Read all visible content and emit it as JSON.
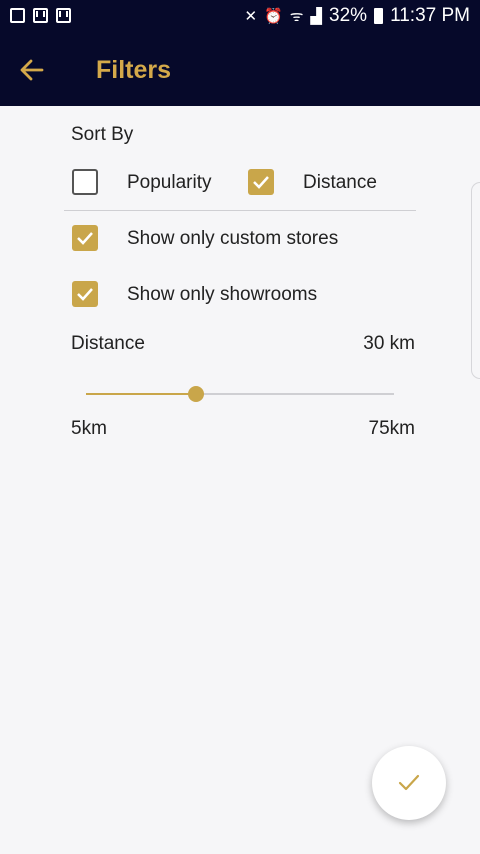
{
  "status_bar": {
    "battery": "32%",
    "time": "11:37 PM",
    "icons": [
      "gallery-icon",
      "gmail-icon",
      "gmail-icon",
      "mute-icon",
      "alarm-icon",
      "wifi-icon",
      "signal-icon",
      "battery-icon"
    ]
  },
  "app_bar": {
    "title": "Filters",
    "back_icon": "arrow-left-icon"
  },
  "colors": {
    "header_bg": "#06092a",
    "accent": "#d4a94a",
    "checkbox": "#c9a64a",
    "background": "#f6f6f8"
  },
  "sort": {
    "label": "Sort By",
    "options": [
      {
        "label": "Popularity",
        "checked": false
      },
      {
        "label": "Distance",
        "checked": true
      }
    ]
  },
  "toggles": [
    {
      "label": "Show only custom stores",
      "checked": true
    },
    {
      "label": "Show only showrooms",
      "checked": true
    }
  ],
  "distance": {
    "label": "Distance",
    "value_text": "30 km",
    "min_label": "5km",
    "max_label": "75km",
    "value_km": 30,
    "min_km": 5,
    "max_km": 75
  },
  "fab": {
    "icon": "check-icon"
  }
}
